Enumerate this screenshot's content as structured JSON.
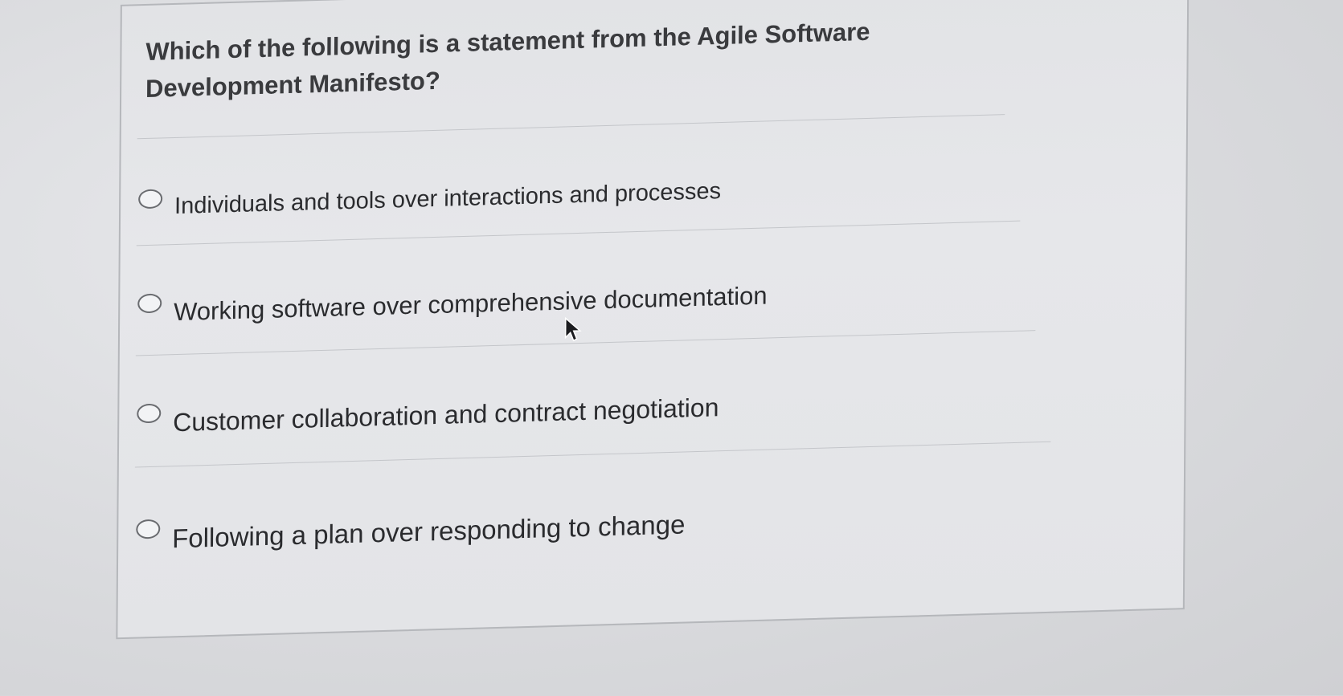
{
  "question": {
    "text": "Which of the following is a statement from the Agile Software Development Manifesto?"
  },
  "options": [
    {
      "label": "Individuals and tools over interactions and processes",
      "selected": false
    },
    {
      "label": "Working software over comprehensive documentation",
      "selected": false
    },
    {
      "label": "Customer collaboration and contract negotiation",
      "selected": false
    },
    {
      "label": "Following a plan over responding to change",
      "selected": false
    }
  ],
  "icons": {
    "radio": "radio-unchecked-icon",
    "cursor": "mouse-pointer-icon"
  },
  "colors": {
    "background": "#d6d7da",
    "card": "#e4e5e8",
    "text": "#2a2b2e",
    "divider": "#c4c6ca"
  }
}
